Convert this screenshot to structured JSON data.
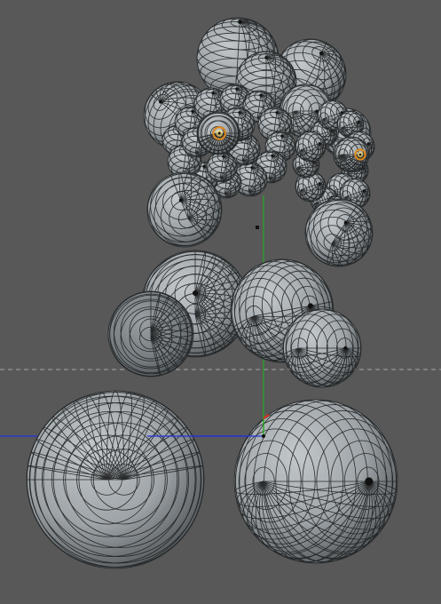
{
  "app": {
    "view": "3D viewport",
    "mode": "wireframe-shaded"
  },
  "colors": {
    "background": "#585858",
    "sphere_fill": "#9ea4a8",
    "sphere_shadow": "#3f4447",
    "wire": "#1d1f20",
    "x_axis": "#2233dd",
    "y_axis": "#22aa22",
    "z_axis": "#dd3322",
    "horizon": "#a9a9a9",
    "highlight_orange": "#e08a1a",
    "highlight_yellow": "#ffe27a"
  },
  "icons": {
    "origin": "origin-marker-icon",
    "axis_gizmo": "axis-gizmo-icon"
  }
}
